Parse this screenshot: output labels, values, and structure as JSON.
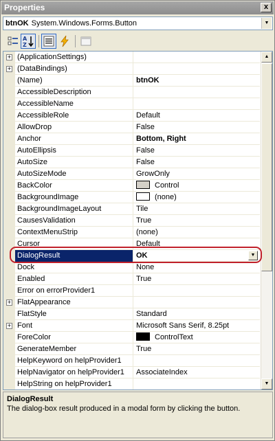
{
  "window": {
    "title": "Properties",
    "close_glyph": "x"
  },
  "selector": {
    "object_name": "btnOK",
    "object_type": "System.Windows.Forms.Button"
  },
  "toolbar": {
    "buttons": [
      {
        "name": "categorized-view-button",
        "icon": "categorized-icon",
        "pressed": false
      },
      {
        "name": "alphabetical-view-button",
        "icon": "az-sort-icon",
        "pressed": true
      },
      {
        "name": "properties-view-button",
        "icon": "properties-list-icon",
        "pressed": true
      },
      {
        "name": "events-view-button",
        "icon": "lightning-icon",
        "pressed": false
      },
      {
        "name": "property-pages-button",
        "icon": "property-pages-icon",
        "pressed": false
      }
    ]
  },
  "properties": [
    {
      "name": "(ApplicationSettings)",
      "value": "",
      "expand": true
    },
    {
      "name": "(DataBindings)",
      "value": "",
      "expand": true
    },
    {
      "name": "(Name)",
      "value": "btnOK",
      "bold": true
    },
    {
      "name": "AccessibleDescription",
      "value": ""
    },
    {
      "name": "AccessibleName",
      "value": ""
    },
    {
      "name": "AccessibleRole",
      "value": "Default"
    },
    {
      "name": "AllowDrop",
      "value": "False"
    },
    {
      "name": "Anchor",
      "value": "Bottom, Right",
      "bold": true
    },
    {
      "name": "AutoEllipsis",
      "value": "False"
    },
    {
      "name": "AutoSize",
      "value": "False"
    },
    {
      "name": "AutoSizeMode",
      "value": "GrowOnly"
    },
    {
      "name": "BackColor",
      "value": "Control",
      "swatch": "#d4d0c8"
    },
    {
      "name": "BackgroundImage",
      "value": "(none)",
      "swatch": "#ffffff"
    },
    {
      "name": "BackgroundImageLayout",
      "value": "Tile"
    },
    {
      "name": "CausesValidation",
      "value": "True"
    },
    {
      "name": "ContextMenuStrip",
      "value": "(none)"
    },
    {
      "name": "Cursor",
      "value": "Default"
    },
    {
      "name": "DialogResult",
      "value": "OK",
      "selected": true
    },
    {
      "name": "Dock",
      "value": "None"
    },
    {
      "name": "Enabled",
      "value": "True"
    },
    {
      "name": "Error on errorProvider1",
      "value": ""
    },
    {
      "name": "FlatAppearance",
      "value": "",
      "expand": true
    },
    {
      "name": "FlatStyle",
      "value": "Standard"
    },
    {
      "name": "Font",
      "value": "Microsoft Sans Serif, 8.25pt",
      "expand": true
    },
    {
      "name": "ForeColor",
      "value": "ControlText",
      "swatch": "#000000"
    },
    {
      "name": "GenerateMember",
      "value": "True"
    },
    {
      "name": "HelpKeyword on helpProvider1",
      "value": ""
    },
    {
      "name": "HelpNavigator on helpProvider1",
      "value": "AssociateIndex"
    },
    {
      "name": "HelpString on helpProvider1",
      "value": ""
    }
  ],
  "description": {
    "title": "DialogResult",
    "text": "The dialog-box result produced in a modal form by clicking the button."
  },
  "colors": {
    "selection": "#0a246a",
    "highlight_ring": "#c0202a",
    "chrome": "#ece9d8"
  }
}
